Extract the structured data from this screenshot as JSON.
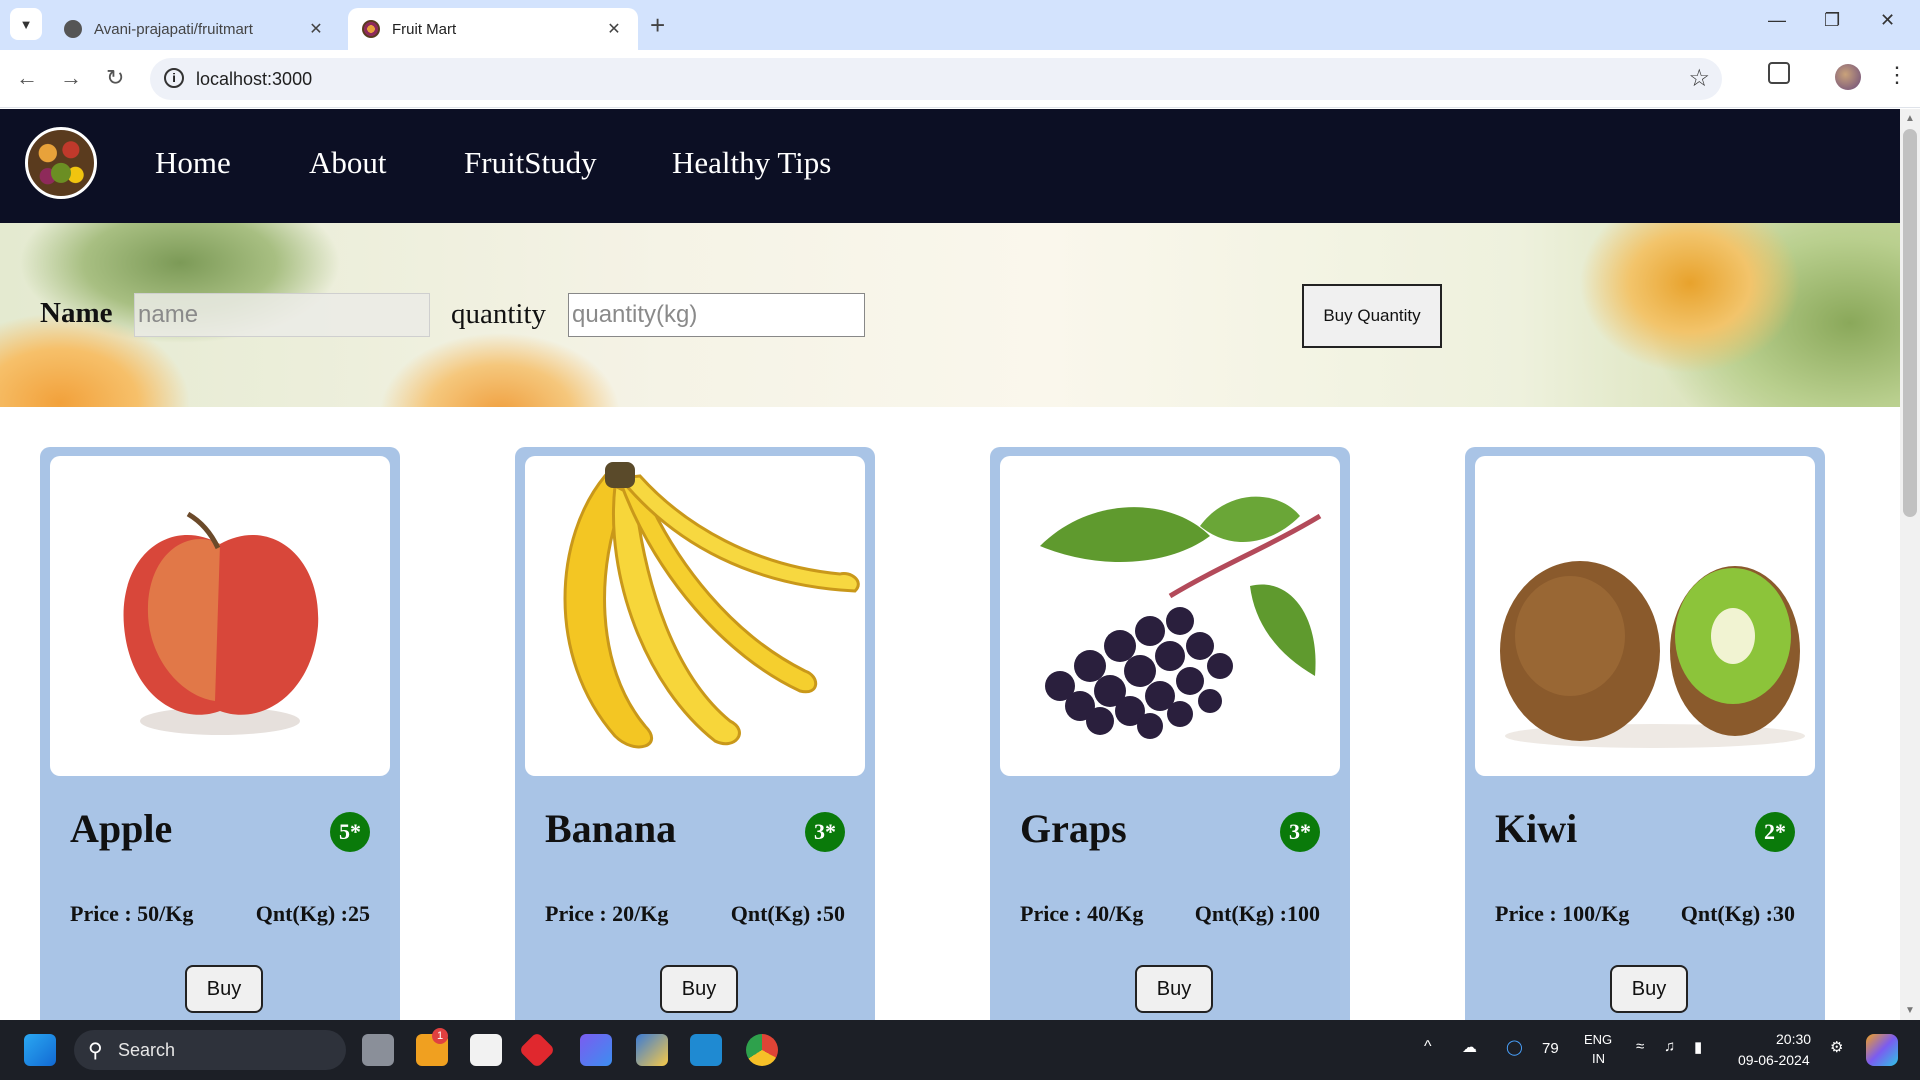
{
  "browser": {
    "tabs": [
      {
        "title": "Avani-prajapati/fruitmart",
        "active": false
      },
      {
        "title": "Fruit Mart",
        "active": true
      }
    ],
    "url": "localhost:3000"
  },
  "site": {
    "nav": [
      {
        "label": "Home"
      },
      {
        "label": "About"
      },
      {
        "label": "FruitStudy"
      },
      {
        "label": "Healthy Tips"
      }
    ],
    "form": {
      "name_label": "Name",
      "name_placeholder": "name",
      "quantity_label": "quantity",
      "quantity_placeholder": "quantity(kg)",
      "buy_quantity_label": "Buy Quantity"
    },
    "products": [
      {
        "name": "Apple",
        "rating": "5*",
        "price": "Price : 50/Kg",
        "qnt": "Qnt(Kg) :25",
        "buy": "Buy",
        "image": "apple-image"
      },
      {
        "name": "Banana",
        "rating": "3*",
        "price": "Price : 20/Kg",
        "qnt": "Qnt(Kg) :50",
        "buy": "Buy",
        "image": "banana-image"
      },
      {
        "name": "Graps",
        "rating": "3*",
        "price": "Price : 40/Kg",
        "qnt": "Qnt(Kg) :100",
        "buy": "Buy",
        "image": "grapes-image"
      },
      {
        "name": "Kiwi",
        "rating": "2*",
        "price": "Price : 100/Kg",
        "qnt": "Qnt(Kg) :30",
        "buy": "Buy",
        "image": "kiwi-image"
      }
    ]
  },
  "taskbar": {
    "search_label": "Search",
    "notification_badge": "1",
    "battery": "79",
    "lang_top": "ENG",
    "lang_bottom": "IN",
    "time": "20:30",
    "date": "09-06-2024"
  },
  "colors": {
    "nav_bg": "#0c0f24",
    "card_bg": "#a9c4e6",
    "rating_bg": "#0a7a0a",
    "tabbar_bg": "#d3e3fd"
  }
}
